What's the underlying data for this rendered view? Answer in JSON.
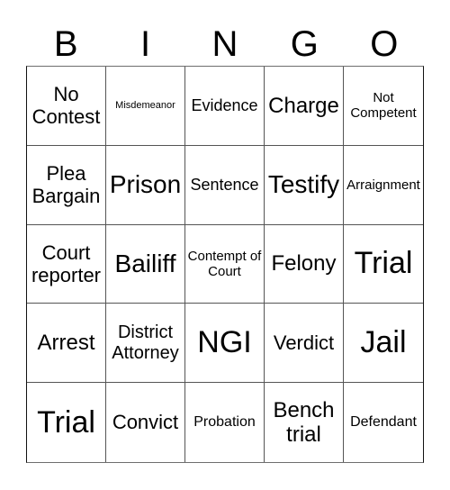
{
  "card": {
    "header": [
      "B",
      "I",
      "N",
      "G",
      "O"
    ],
    "cells": [
      {
        "text": "No Contest",
        "size": "s-ml"
      },
      {
        "text": "Misdemeanor",
        "size": "s-tiny"
      },
      {
        "text": "Evidence",
        "size": "s-s"
      },
      {
        "text": "Charge",
        "size": "s-m"
      },
      {
        "text": "Not Competent",
        "size": "s-xxs"
      },
      {
        "text": "Plea Bargain",
        "size": "s-ml"
      },
      {
        "text": "Prison",
        "size": "s-l"
      },
      {
        "text": "Sentence",
        "size": "s-s"
      },
      {
        "text": "Testify",
        "size": "s-l"
      },
      {
        "text": "Arraignment",
        "size": "s-xxs"
      },
      {
        "text": "Court reporter",
        "size": "s-ml"
      },
      {
        "text": "Bailiff",
        "size": "s-l"
      },
      {
        "text": "Contempt of Court",
        "size": "s-xxs"
      },
      {
        "text": "Felony",
        "size": "s-m"
      },
      {
        "text": "Trial",
        "size": "s-xl"
      },
      {
        "text": "Arrest",
        "size": "s-m"
      },
      {
        "text": "District Attorney",
        "size": "s-sm"
      },
      {
        "text": "NGI",
        "size": "s-xl"
      },
      {
        "text": "Verdict",
        "size": "s-ml"
      },
      {
        "text": "Jail",
        "size": "s-xl"
      },
      {
        "text": "Trial",
        "size": "s-xl"
      },
      {
        "text": "Convict",
        "size": "s-ml"
      },
      {
        "text": "Probation",
        "size": "s-xs"
      },
      {
        "text": "Bench trial",
        "size": "s-m"
      },
      {
        "text": "Defendant",
        "size": "s-xs"
      }
    ]
  }
}
